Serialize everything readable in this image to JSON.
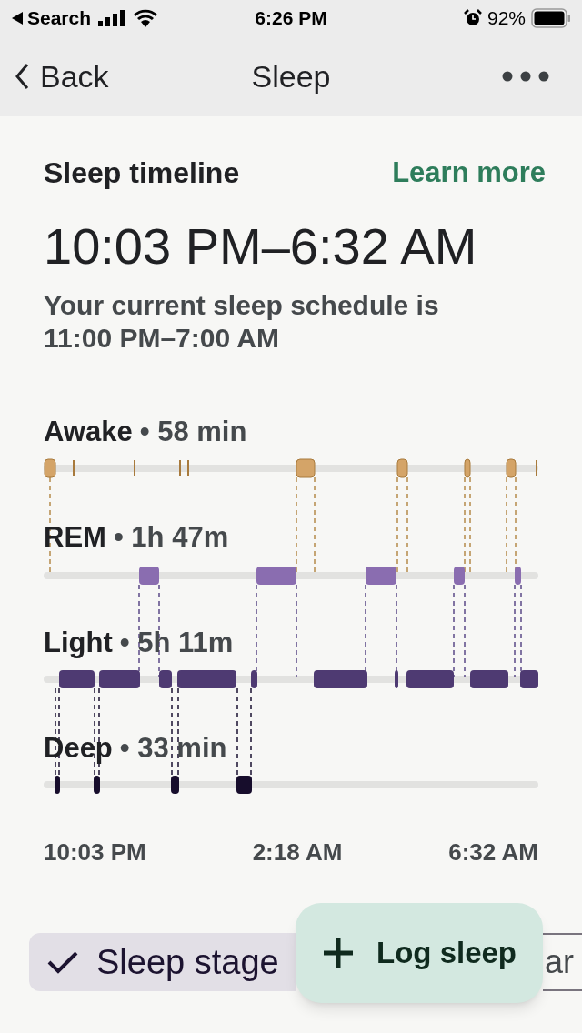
{
  "status_bar": {
    "back_label": "Search",
    "time": "6:26 PM",
    "battery": "92%"
  },
  "nav": {
    "back": "Back",
    "title": "Sleep"
  },
  "timeline": {
    "title": "Sleep timeline",
    "link": "Learn more",
    "range": "10:03 PM–6:32 AM",
    "schedule": "Your current sleep schedule is 11:00 PM–7:00 AM",
    "stages": [
      {
        "name": "Awake",
        "duration": "• 58 min"
      },
      {
        "name": "REM",
        "duration": "• 1h 47m"
      },
      {
        "name": "Light",
        "duration": "• 5h 11m"
      },
      {
        "name": "Deep",
        "duration": "• 33 min"
      }
    ],
    "time_axis": [
      "10:03 PM",
      "2:18 AM",
      "6:32 AM"
    ]
  },
  "chips": [
    {
      "label": "Sleep stage",
      "selected": true
    },
    {
      "label": "ar",
      "selected": false
    }
  ],
  "fab": {
    "label": "Log sleep"
  }
}
